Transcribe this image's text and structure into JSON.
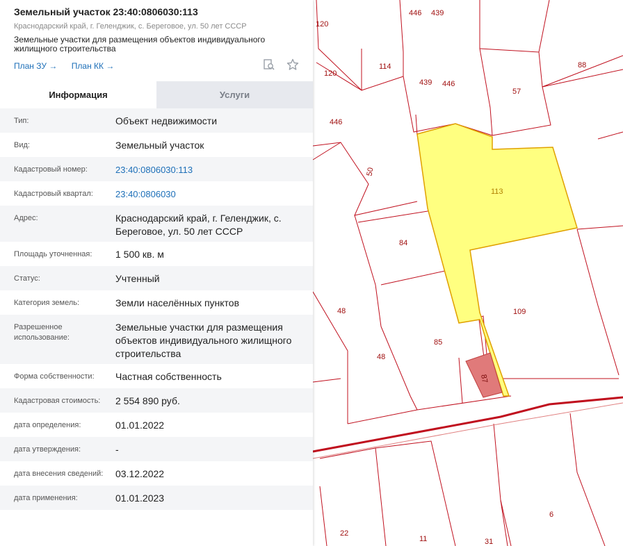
{
  "object": {
    "title": "Земельный участок 23:40:0806030:113",
    "address": "Краснодарский край, г. Геленджик, с. Береговое, ул. 50 лет СССР",
    "description": "Земельные участки для размещения объектов индивидуального жилищного строительства"
  },
  "links": {
    "plan_zu": "План ЗУ →",
    "plan_kk": "План КК →"
  },
  "icons": {
    "search": "search-document-icon",
    "favorite": "star-icon"
  },
  "tabs": {
    "info": "Информация",
    "services": "Услуги"
  },
  "details": [
    {
      "label": "Тип:",
      "value": "Объект недвижимости"
    },
    {
      "label": "Вид:",
      "value": "Земельный участок"
    },
    {
      "label": "Кадастровый номер:",
      "value": "23:40:0806030:113"
    },
    {
      "label": "Кадастровый квартал:",
      "value": "23:40:0806030"
    },
    {
      "label": "Адрес:",
      "value": "Краснодарский край, г. Геленджик, с. Береговое, ул. 50 лет СССР"
    },
    {
      "label": "Площадь уточненная:",
      "value": "1 500 кв. м"
    },
    {
      "label": "Статус:",
      "value": "Учтенный"
    },
    {
      "label": "Категория земель:",
      "value": "Земли населённых пунктов"
    },
    {
      "label": "Разрешенное использование:",
      "value": "Земельные участки для размещения объектов индивидуального жилищного строительства"
    },
    {
      "label": "Форма собственности:",
      "value": "Частная собственность"
    },
    {
      "label": "Кадастровая стоимость:",
      "value": "2 554 890 руб."
    },
    {
      "label": "дата определения:",
      "value": "01.01.2022"
    },
    {
      "label": "дата утверждения:",
      "value": "-"
    },
    {
      "label": "дата внесения сведений:",
      "value": "03.12.2022"
    },
    {
      "label": "дата применения:",
      "value": "01.01.2023"
    }
  ],
  "map": {
    "colors": {
      "boundary": "#c0101e",
      "selected_fill": "#ffff80",
      "selected_stroke": "#e0a000",
      "building": "#e07a7a",
      "road": "#c0101e"
    },
    "labels": {
      "p446a": "446",
      "p439a": "439",
      "p120a": "120",
      "p120b": "120",
      "p114": "114",
      "p439b": "439",
      "p446b": "446",
      "p57": "57",
      "p88": "88",
      "p446c": "446",
      "p50": "50",
      "p113": "113",
      "p84": "84",
      "p48a": "48",
      "p48b": "48",
      "p85": "85",
      "p109": "109",
      "pbld": "87",
      "p6": "6",
      "p22": "22",
      "p11": "11",
      "p31": "31"
    }
  }
}
